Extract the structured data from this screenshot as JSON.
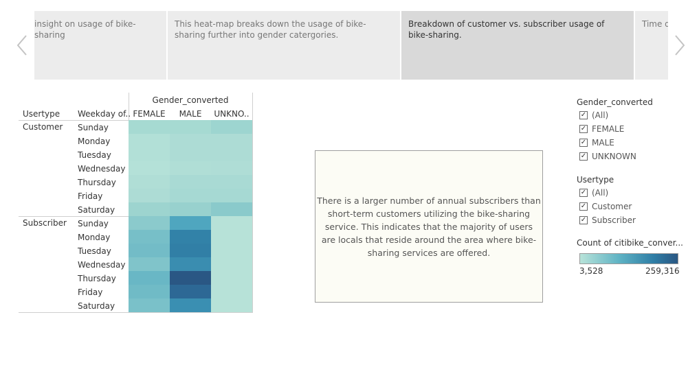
{
  "navigation": {
    "prev_icon": "chevron-left-icon",
    "next_icon": "chevron-right-icon"
  },
  "story_points": [
    {
      "text": "insight on usage of bike-sharing",
      "active": false
    },
    {
      "text": "This heat-map breaks down the usage of bike-sharing further into gender catergories.",
      "active": false
    },
    {
      "text": "Breakdown of customer vs. subscriber usage of bike-sharing.",
      "active": true
    },
    {
      "text": "Time d minute",
      "active": false
    }
  ],
  "heatmap": {
    "column_group_title": "Gender_converted",
    "row_headers": [
      "Usertype",
      "Weekday of.."
    ],
    "columns": [
      "FEMALE",
      "MALE",
      "UNKNO.."
    ],
    "groups": [
      {
        "usertype": "Customer",
        "rows": [
          {
            "weekday": "Sunday",
            "colors": [
              "#a6dad2",
              "#a6dad2",
              "#9dd5d0"
            ]
          },
          {
            "weekday": "Monday",
            "colors": [
              "#b2e0d7",
              "#addcd5",
              "#addcd5"
            ]
          },
          {
            "weekday": "Tuesday",
            "colors": [
              "#b2e0d7",
              "#addcd5",
              "#addcd5"
            ]
          },
          {
            "weekday": "Wednesday",
            "colors": [
              "#b4e1d8",
              "#b0ded6",
              "#afddd6"
            ]
          },
          {
            "weekday": "Thursday",
            "colors": [
              "#b0ded6",
              "#a9dad4",
              "#a9dad4"
            ]
          },
          {
            "weekday": "Friday",
            "colors": [
              "#addcd5",
              "#a6d9d3",
              "#a6d9d3"
            ]
          },
          {
            "weekday": "Saturday",
            "colors": [
              "#9dd4cf",
              "#98d1ce",
              "#8acacb"
            ]
          }
        ]
      },
      {
        "usertype": "Subscriber",
        "rows": [
          {
            "weekday": "Sunday",
            "colors": [
              "#8bcacc",
              "#4fa6bf",
              "#b7e2d8"
            ]
          },
          {
            "weekday": "Monday",
            "colors": [
              "#77bfc8",
              "#3282a8",
              "#b7e2d8"
            ]
          },
          {
            "weekday": "Tuesday",
            "colors": [
              "#73bcc7",
              "#317fa6",
              "#b7e2d8"
            ]
          },
          {
            "weekday": "Wednesday",
            "colors": [
              "#80c4ca",
              "#3a8db0",
              "#b7e2d8"
            ]
          },
          {
            "weekday": "Thursday",
            "colors": [
              "#69b7c5",
              "#2a5784",
              "#b7e2d8"
            ]
          },
          {
            "weekday": "Friday",
            "colors": [
              "#70bbc6",
              "#2d6895",
              "#b7e2d8"
            ]
          },
          {
            "weekday": "Saturday",
            "colors": [
              "#7ac1c9",
              "#3a8fb2",
              "#b7e2d8"
            ]
          }
        ]
      }
    ]
  },
  "annotation": {
    "text": "There is a larger number of annual subscribers than short-term customers utilizing the bike-sharing service. This indicates that the majority of users are locals that reside around the area where bike-sharing services are offered."
  },
  "filters": [
    {
      "title": "Gender_converted",
      "items": [
        {
          "label": "(All)",
          "checked": true
        },
        {
          "label": "FEMALE",
          "checked": true
        },
        {
          "label": "MALE",
          "checked": true
        },
        {
          "label": "UNKNOWN",
          "checked": true
        }
      ]
    },
    {
      "title": "Usertype",
      "items": [
        {
          "label": "(All)",
          "checked": true
        },
        {
          "label": "Customer",
          "checked": true
        },
        {
          "label": "Subscriber",
          "checked": true
        }
      ]
    }
  ],
  "color_legend": {
    "title": "Count of citibike_conver...",
    "min_label": "3,528",
    "max_label": "259,316",
    "colors": [
      "#b8e3d9",
      "#2a5783"
    ]
  }
}
